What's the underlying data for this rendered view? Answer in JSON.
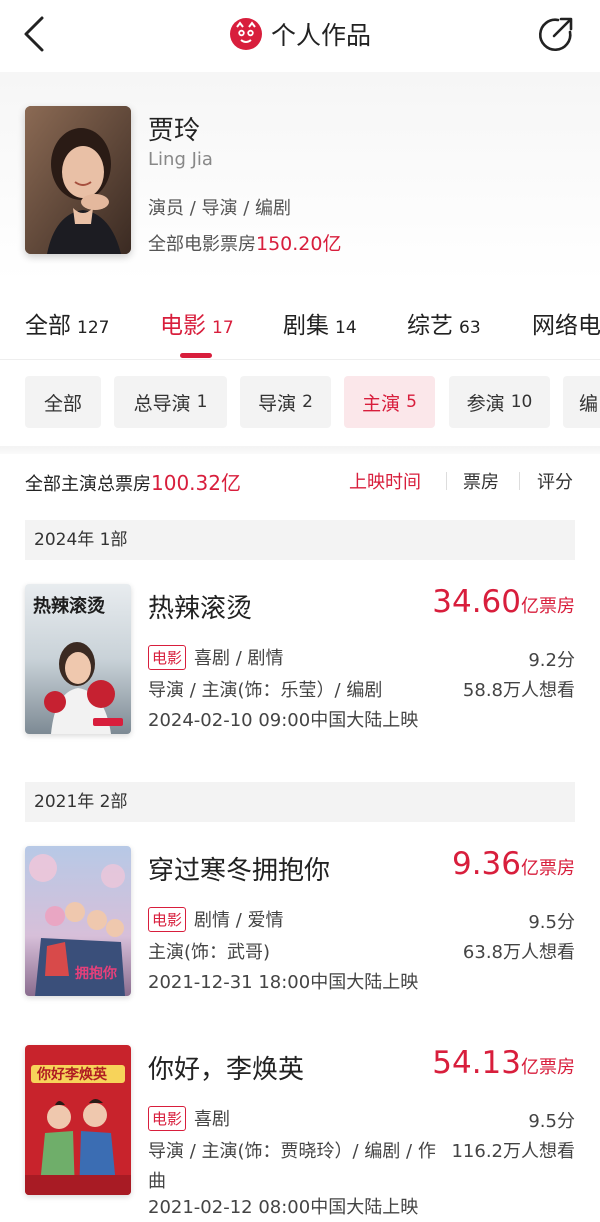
{
  "header": {
    "title": "个人作品"
  },
  "profile": {
    "name_cn": "贾玲",
    "name_en": "Ling Jia",
    "roles": "演员 / 导演 / 编剧",
    "total_label": "全部电影票房",
    "total_value": "150.20亿"
  },
  "tabs": [
    {
      "label": "全部",
      "count": "127"
    },
    {
      "label": "电影",
      "count": "17"
    },
    {
      "label": "剧集",
      "count": "14"
    },
    {
      "label": "综艺",
      "count": "63"
    },
    {
      "label": "网络电"
    }
  ],
  "chips": [
    {
      "label": "全部",
      "count": ""
    },
    {
      "label": "总导演",
      "count": "1"
    },
    {
      "label": "导演",
      "count": "2"
    },
    {
      "label": "主演",
      "count": "5"
    },
    {
      "label": "参演",
      "count": "10"
    },
    {
      "label": "编",
      "count": ""
    }
  ],
  "sort": {
    "total_label": "全部主演总票房",
    "total_value": "100.32亿",
    "options": [
      "上映时间",
      "票房",
      "评分"
    ]
  },
  "years": [
    {
      "label": "2024年  1部"
    },
    {
      "label": "2021年  2部"
    }
  ],
  "movies": [
    {
      "title": "热辣滚烫",
      "box_num": "34.60",
      "box_unit": "亿票房",
      "badge": "电影",
      "genre": "喜剧 / 剧情",
      "score": "9.2分",
      "credit": "导演 / 主演(饰：乐莹）/ 编剧",
      "want": "58.8万人想看",
      "date": "2024-02-10 09:00中国大陆上映",
      "poster_text": "热辣滚烫"
    },
    {
      "title": "穿过寒冬拥抱你",
      "box_num": "9.36",
      "box_unit": "亿票房",
      "badge": "电影",
      "genre": "剧情 / 爱情",
      "score": "9.5分",
      "credit": "主演(饰：武哥)",
      "want": "63.8万人想看",
      "date": "2021-12-31 18:00中国大陆上映",
      "poster_text": "拥抱你"
    },
    {
      "title": "你好，李焕英",
      "box_num": "54.13",
      "box_unit": "亿票房",
      "badge": "电影",
      "genre": "喜剧",
      "score": "9.5分",
      "credit": "导演 / 主演(饰：贾晓玲）/ 编剧 / 作曲",
      "want": "116.2万人想看",
      "date": "2021-02-12 08:00中国大陆上映",
      "poster_text": "你好李焕英"
    }
  ],
  "colors": {
    "accent": "#d81e3c"
  }
}
